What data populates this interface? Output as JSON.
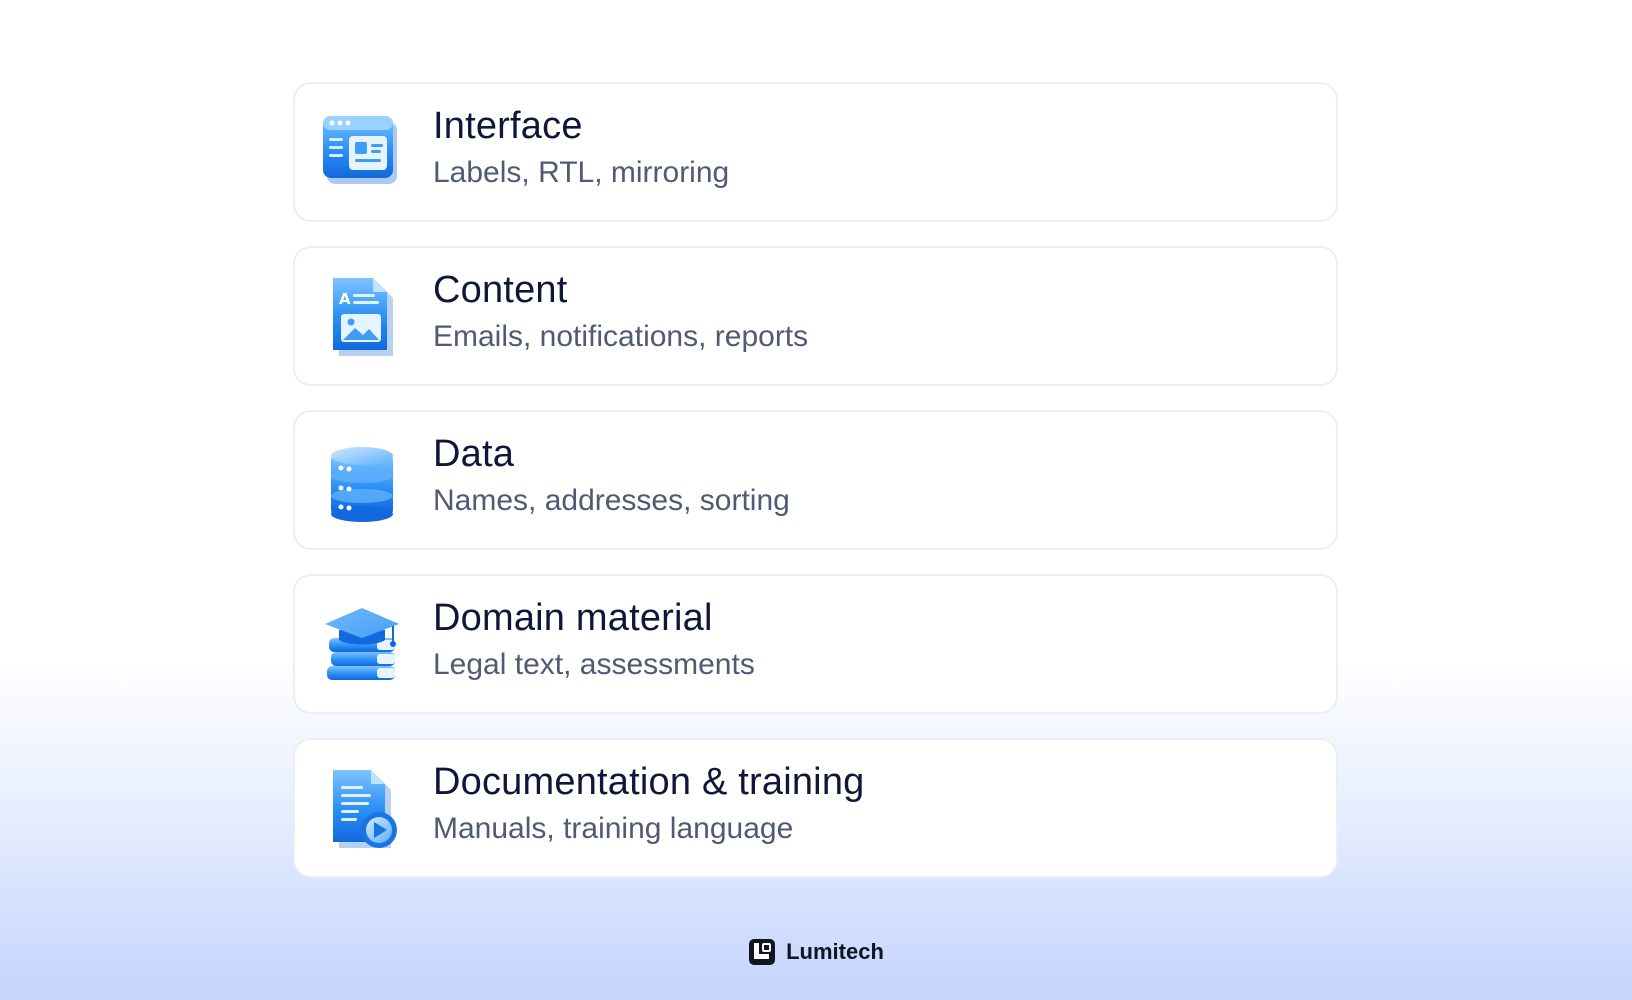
{
  "cards": [
    {
      "title": "Interface",
      "subtitle": "Labels, RTL, mirroring",
      "icon": "browser-window-icon"
    },
    {
      "title": "Content",
      "subtitle": "Emails, notifications, reports",
      "icon": "document-image-icon"
    },
    {
      "title": "Data",
      "subtitle": "Names, addresses, sorting",
      "icon": "database-icon"
    },
    {
      "title": "Domain material",
      "subtitle": "Legal text, assessments",
      "icon": "graduation-books-icon"
    },
    {
      "title": "Documentation & training",
      "subtitle": "Manuals, training language",
      "icon": "document-video-icon"
    }
  ],
  "footer": {
    "brand": "Lumitech",
    "logo_icon": "lumitech-logo-icon"
  },
  "colors": {
    "title": "#0f1738",
    "subtitle": "#505a73",
    "icon_blue": "#1f8cf2",
    "card_border": "#eceef3"
  }
}
